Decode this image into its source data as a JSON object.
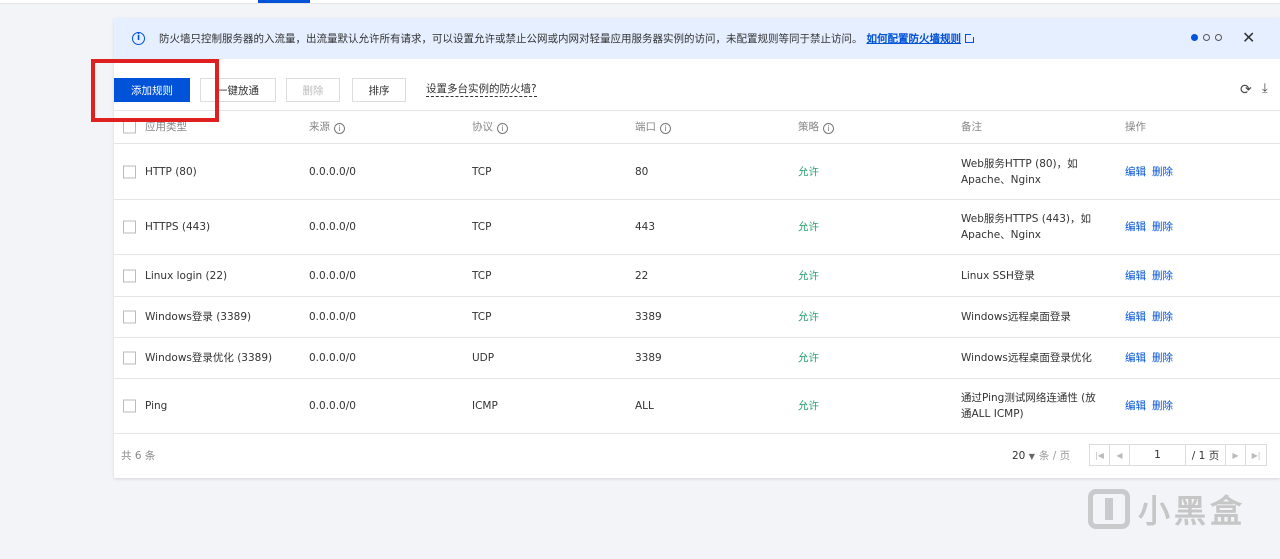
{
  "notice": {
    "text": "防火墙只控制服务器的入流量，出流量默认允许所有请求，可以设置允许或禁止公网或内网对轻量应用服务器实例的访问，未配置规则等同于禁止访问。",
    "link": "如何配置防火墙规则"
  },
  "toolbar": {
    "add": "添加规则",
    "open": "一键放通",
    "delete": "删除",
    "sort": "排序",
    "multi": "设置多台实例的防火墙?"
  },
  "columns": {
    "type": "应用类型",
    "source": "来源",
    "protocol": "协议",
    "port": "端口",
    "policy": "策略",
    "note": "备注",
    "ops": "操作"
  },
  "rows": [
    {
      "type": "HTTP (80)",
      "source": "0.0.0.0/0",
      "protocol": "TCP",
      "port": "80",
      "policy": "允许",
      "note": "Web服务HTTP (80)，如Apache、Nginx",
      "edit": "编辑",
      "del": "删除"
    },
    {
      "type": "HTTPS (443)",
      "source": "0.0.0.0/0",
      "protocol": "TCP",
      "port": "443",
      "policy": "允许",
      "note": "Web服务HTTPS (443)，如Apache、Nginx",
      "edit": "编辑",
      "del": "删除"
    },
    {
      "type": "Linux login (22)",
      "source": "0.0.0.0/0",
      "protocol": "TCP",
      "port": "22",
      "policy": "允许",
      "note": "Linux SSH登录",
      "edit": "编辑",
      "del": "删除"
    },
    {
      "type": "Windows登录 (3389)",
      "source": "0.0.0.0/0",
      "protocol": "TCP",
      "port": "3389",
      "policy": "允许",
      "note": "Windows远程桌面登录",
      "edit": "编辑",
      "del": "删除"
    },
    {
      "type": "Windows登录优化 (3389)",
      "source": "0.0.0.0/0",
      "protocol": "UDP",
      "port": "3389",
      "policy": "允许",
      "note": "Windows远程桌面登录优化",
      "edit": "编辑",
      "del": "删除"
    },
    {
      "type": "Ping",
      "source": "0.0.0.0/0",
      "protocol": "ICMP",
      "port": "ALL",
      "policy": "允许",
      "note": "通过Ping测试网络连通性 (放通ALL ICMP)",
      "edit": "编辑",
      "del": "删除"
    }
  ],
  "footer": {
    "total": "共 6 条",
    "page_size": "20",
    "page_size_unit": "条 / 页",
    "current_page": "1",
    "total_pages": "/ 1 页"
  },
  "watermark": "小黑盒",
  "colors": {
    "primary": "#0052d9",
    "allow": "#2ba471",
    "highlight": "#e02020"
  }
}
